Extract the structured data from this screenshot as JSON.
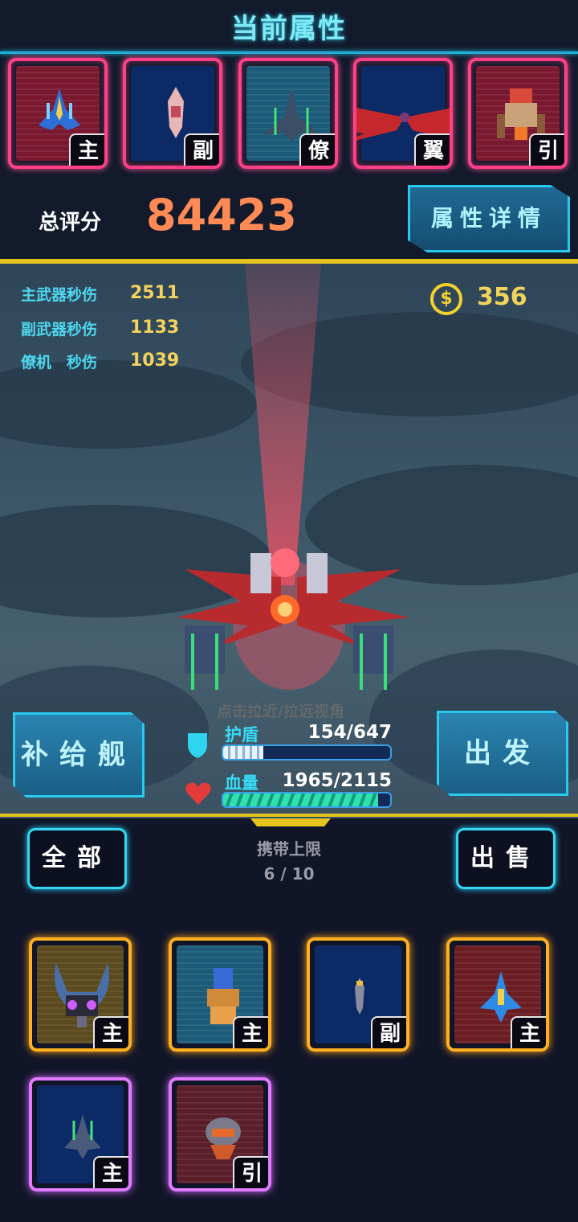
{
  "header": {
    "title": "当前属性"
  },
  "equipped_slots": [
    {
      "tag": "主",
      "icon": "blue-fighter-ship-icon"
    },
    {
      "tag": "副",
      "icon": "missile-pod-icon"
    },
    {
      "tag": "僚",
      "icon": "wingman-ship-icon"
    },
    {
      "tag": "翼",
      "icon": "red-wings-icon"
    },
    {
      "tag": "引",
      "icon": "engine-module-icon"
    }
  ],
  "score": {
    "label": "总评分",
    "value": "84423"
  },
  "detail_button": {
    "label": "属性详情"
  },
  "stats": [
    {
      "label": "主武器秒伤",
      "value": "2511"
    },
    {
      "label": "副武器秒伤",
      "value": "1133"
    },
    {
      "label": "僚机　秒伤",
      "value": "1039"
    }
  ],
  "coins": {
    "icon": "coin-icon",
    "value": "356"
  },
  "supply_button": {
    "label": "补给舰"
  },
  "depart_button": {
    "label": "出发"
  },
  "hint": "点击拉近/拉远视角",
  "shield": {
    "label": "护盾",
    "value": "154/647",
    "fraction": 0.24
  },
  "health": {
    "label": "血量",
    "value": "1965/2115",
    "fraction": 0.93
  },
  "colors": {
    "shield": "#2fd5f0",
    "health": "#e33a3a",
    "accent": "#29c8ef",
    "score": "#ff8a55"
  },
  "inventory": {
    "filter_button": "全部",
    "sell_button": "出售",
    "carry_label": "携带上限",
    "carry_value": "6 / 10",
    "items": [
      {
        "tag": "主",
        "icon": "purple-eyed-ship-icon",
        "rarity": "gold"
      },
      {
        "tag": "主",
        "icon": "orange-cannon-ship-icon",
        "rarity": "gold"
      },
      {
        "tag": "副",
        "icon": "missile-icon",
        "rarity": "gold"
      },
      {
        "tag": "主",
        "icon": "blue-jet-ship-icon",
        "rarity": "gold"
      },
      {
        "tag": "主",
        "icon": "green-scout-ship-icon",
        "rarity": "purple"
      },
      {
        "tag": "引",
        "icon": "engine-pod-icon",
        "rarity": "purple"
      }
    ]
  }
}
